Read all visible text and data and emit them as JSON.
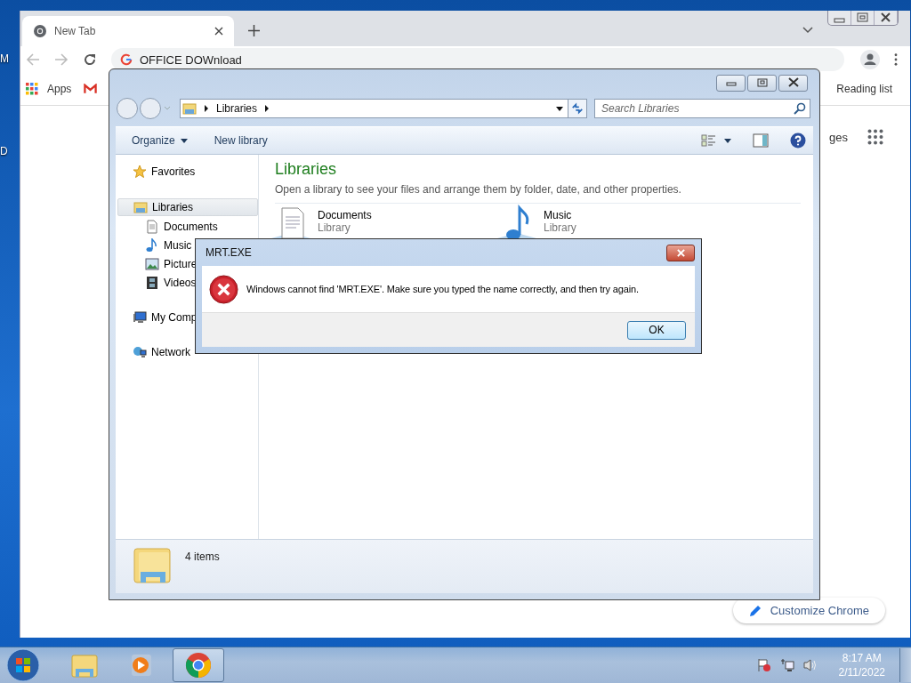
{
  "desktop": {
    "icon_labels": [
      "M",
      "D"
    ]
  },
  "chrome": {
    "tabs": [
      {
        "label": "New Tab",
        "selected": true
      }
    ],
    "address": "OFFICE DOWnload",
    "bookmarks": [
      {
        "label": "Apps",
        "kind": "apps"
      },
      {
        "kind": "gmail"
      }
    ],
    "reading_list": "Reading list",
    "images_link": "ges",
    "customize": "Customize Chrome"
  },
  "explorer": {
    "breadcrumb": [
      "Libraries"
    ],
    "search": {
      "placeholder": "Search Libraries"
    },
    "commands": [
      {
        "label": "Organize",
        "dropdown": true
      },
      {
        "label": "New library",
        "dropdown": false
      }
    ],
    "nav": [
      {
        "label": "Favorites",
        "kind": "star",
        "selected": false
      },
      {
        "label": "Libraries",
        "kind": "library",
        "selected": true,
        "children": [
          {
            "label": "Documents",
            "kind": "document",
            "selected": false
          },
          {
            "label": "Music",
            "kind": "music",
            "selected": false
          },
          {
            "label": "Picture",
            "kind": "picture",
            "selected": false
          },
          {
            "label": "Videos",
            "kind": "video",
            "selected": false
          }
        ]
      },
      {
        "label": "My Comp",
        "kind": "computer",
        "selected": false
      },
      {
        "label": "Network",
        "kind": "network",
        "selected": false
      }
    ],
    "heading": "Libraries",
    "description": "Open a library to see your files and arrange them by folder, date, and other properties.",
    "items": [
      {
        "name": "Documents",
        "type": "Library",
        "kind": "document"
      },
      {
        "name": "Music",
        "type": "Library",
        "kind": "music"
      }
    ],
    "status": "4 items"
  },
  "dialog": {
    "title": "MRT.EXE",
    "message": "Windows cannot find 'MRT.EXE'. Make sure you typed the name correctly, and then try again.",
    "button": "OK"
  },
  "taskbar": {
    "buttons": [
      {
        "kind": "explorer",
        "selected": false
      },
      {
        "kind": "media",
        "selected": false
      },
      {
        "kind": "chrome",
        "selected": true
      }
    ],
    "time": "8:17 AM",
    "date": "2/11/2022"
  }
}
